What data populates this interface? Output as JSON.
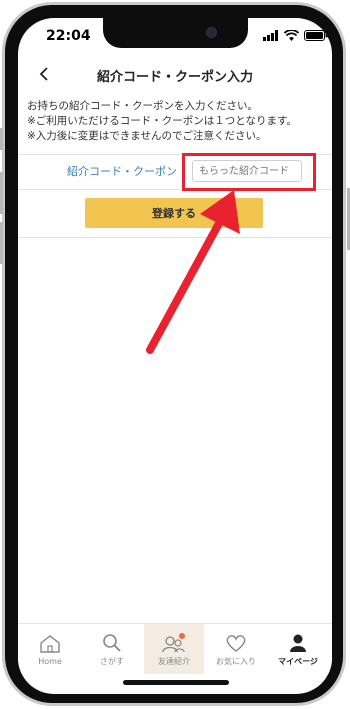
{
  "status_bar": {
    "time": "22:04"
  },
  "header": {
    "title": "紹介コード・クーポン入力"
  },
  "instructions": [
    "お持ちの紹介コード・クーポンを入力ください。",
    "※ご利用いただけるコード・クーポンは１つとなります。",
    "※入力後に変更はできませんのでご注意ください。"
  ],
  "code_form": {
    "label": "紹介コード・クーポン",
    "placeholder": "もらった紹介コード",
    "submit_label": "登録する"
  },
  "tabbar": {
    "items": [
      {
        "label": "Home",
        "icon": "home-icon"
      },
      {
        "label": "さがす",
        "icon": "search-icon"
      },
      {
        "label": "友達紹介",
        "icon": "friends-icon"
      },
      {
        "label": "お気に入り",
        "icon": "heart-icon"
      },
      {
        "label": "マイページ",
        "icon": "person-icon"
      }
    ]
  },
  "colors": {
    "accent_button": "#f2c450",
    "link_blue": "#3a7dc2",
    "highlight_red": "#e8222f",
    "badge_orange": "#ee6a3a"
  }
}
